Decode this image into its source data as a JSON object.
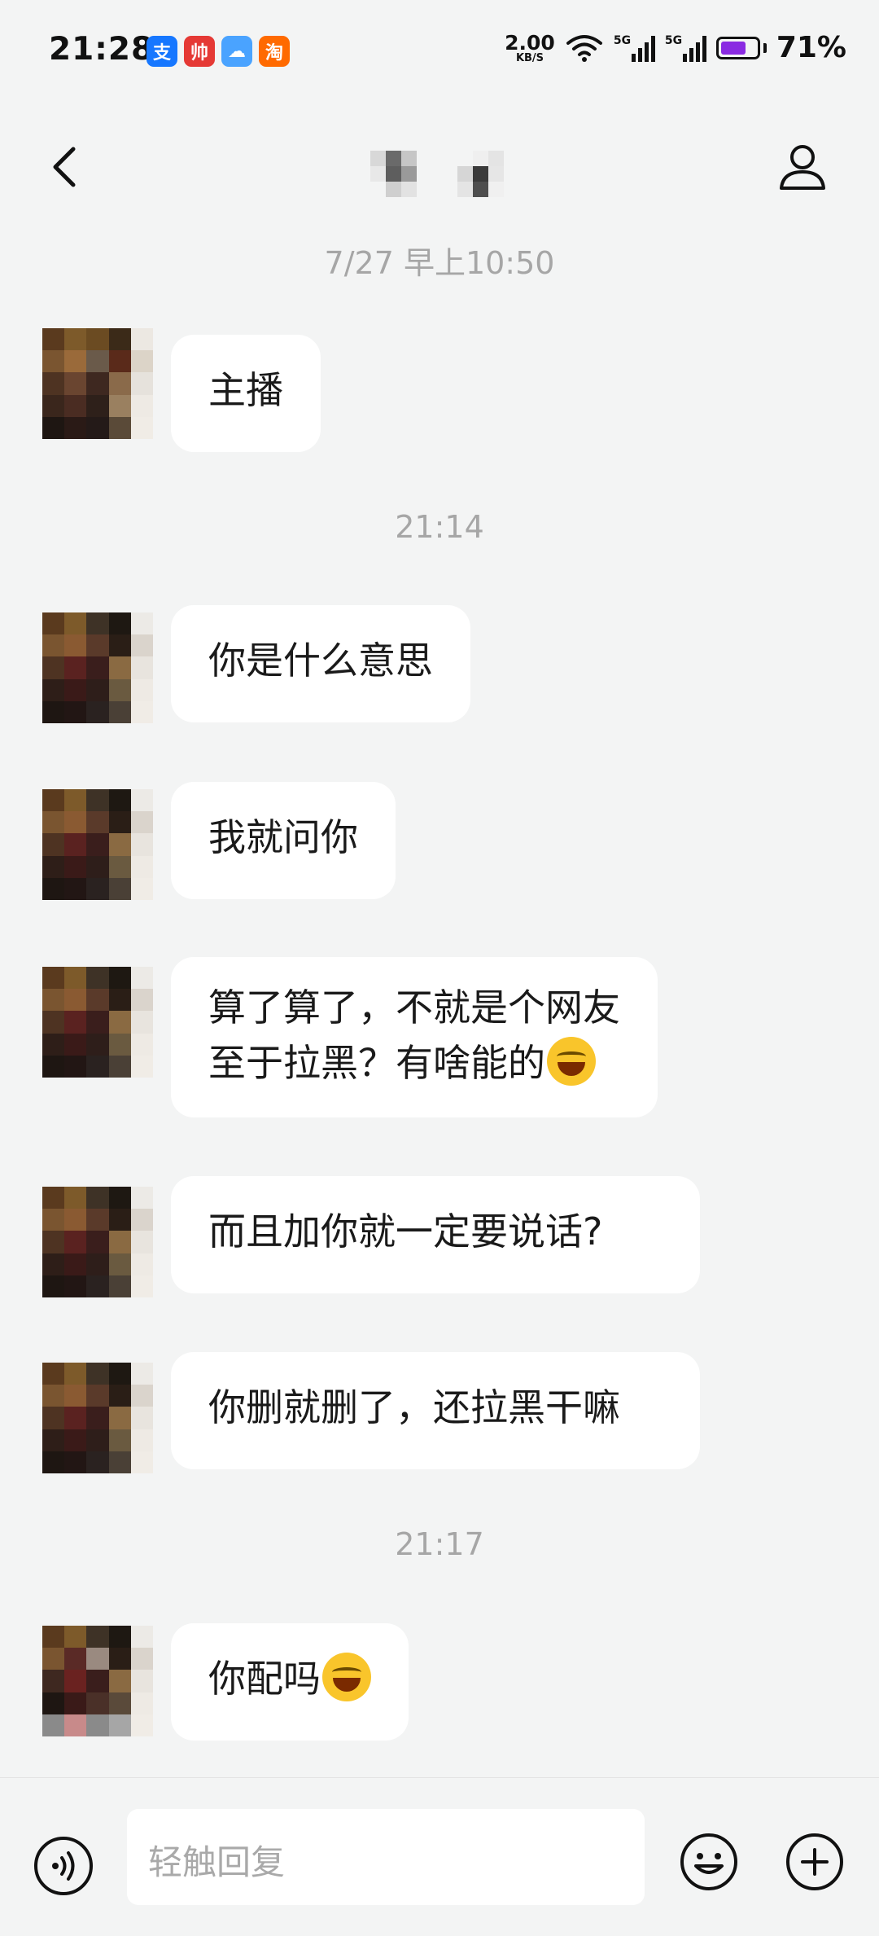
{
  "status_bar": {
    "time": "21:28",
    "apps": [
      {
        "icon": "alipay-icon",
        "glyph": "支",
        "color": "#1677ff"
      },
      {
        "icon": "red-app-icon",
        "glyph": "帅",
        "color": "#e53935"
      },
      {
        "icon": "weather-icon",
        "glyph": "☁",
        "color": "#4aa3ff"
      },
      {
        "icon": "taobao-icon",
        "glyph": "淘",
        "color": "#ff6a00"
      }
    ],
    "net_speed": "2.00",
    "net_unit": "KB/S",
    "sig1_label": "5G",
    "sig2_label": "5G",
    "battery": "71%"
  },
  "header": {
    "title": "",
    "back_icon": "chevron-left-icon",
    "profile_icon": "person-icon"
  },
  "timestamps": {
    "t1": "7/27 早上10:50",
    "t2": "21:14",
    "t3": "21:17"
  },
  "messages": [
    {
      "text": "主播"
    },
    {
      "text": "你是什么意思"
    },
    {
      "text": "我就问你"
    },
    {
      "line1": "算了算了，不就是个网友",
      "line2": "至于拉黑？有啥能的"
    },
    {
      "text": "而且加你就一定要说话?"
    },
    {
      "text": "你删就删了，还拉黑干嘛"
    },
    {
      "text": "你配吗"
    }
  ],
  "input": {
    "placeholder": "轻触回复",
    "voice_icon": "voice-icon",
    "emoji_icon": "smiley-icon",
    "plus_icon": "plus-icon"
  },
  "colors": {
    "background": "#f3f4f4",
    "bubble": "#ffffff",
    "timestamp": "#a6a6a6",
    "battery_accent": "#8a2be2"
  }
}
